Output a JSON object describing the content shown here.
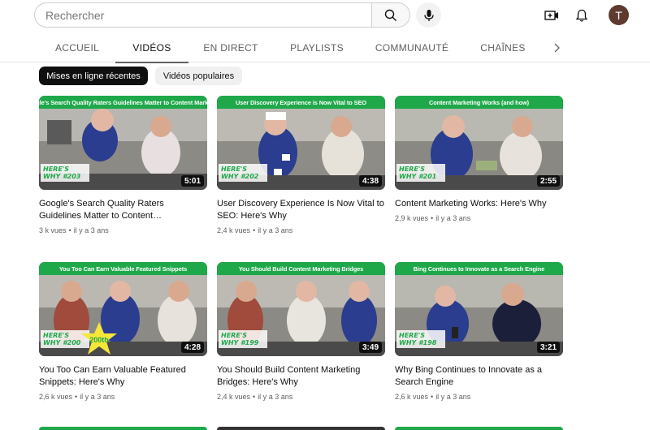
{
  "header": {
    "search_placeholder": "Rechercher",
    "avatar_letter": "T"
  },
  "tabs": [
    {
      "label": "ACCUEIL",
      "active": false
    },
    {
      "label": "VIDÉOS",
      "active": true
    },
    {
      "label": "EN DIRECT",
      "active": false
    },
    {
      "label": "PLAYLISTS",
      "active": false
    },
    {
      "label": "COMMUNAUTÉ",
      "active": false
    },
    {
      "label": "CHAÎNES",
      "active": false
    }
  ],
  "chips": [
    {
      "label": "Mises en ligne récentes",
      "selected": true
    },
    {
      "label": "Vidéos populaires",
      "selected": false
    }
  ],
  "videos": [
    {
      "banner": "Google's Search Quality Raters Guidelines Matter to Content Marketers",
      "logo_line1": "HERE'S",
      "logo_line2": "WHY #203",
      "duration": "5:01",
      "title": "Google's Search Quality Raters Guidelines Matter to Content…",
      "views": "3 k vues",
      "age": "il y a 3 ans"
    },
    {
      "banner": "User Discovery Experience is Now Vital to SEO",
      "logo_line1": "HERE'S",
      "logo_line2": "WHY #202",
      "duration": "4:38",
      "title": "User Discovery Experience Is Now Vital to SEO: Here's Why",
      "views": "2,4 k vues",
      "age": "il y a 3 ans"
    },
    {
      "banner": "Content Marketing Works (and how)",
      "logo_line1": "HERE'S",
      "logo_line2": "WHY #201",
      "duration": "2:55",
      "title": "Content Marketing Works: Here's Why",
      "views": "2,9 k vues",
      "age": "il y a 3 ans"
    },
    {
      "banner": "You Too Can Earn Valuable Featured Snippets",
      "logo_line1": "HERE'S",
      "logo_line2": "WHY #200",
      "duration": "4:28",
      "title": "You Too Can Earn Valuable Featured Snippets: Here's Why",
      "views": "2,6 k vues",
      "age": "il y a 3 ans",
      "star_text": "200th"
    },
    {
      "banner": "You Should Build Content Marketing Bridges",
      "logo_line1": "HERE'S",
      "logo_line2": "WHY #199",
      "duration": "3:49",
      "title": "You Should Build Content Marketing Bridges: Here's Why",
      "views": "2,4 k vues",
      "age": "il y a 3 ans"
    },
    {
      "banner": "Bing Continues to Innovate as a Search Engine",
      "logo_line1": "HERE'S",
      "logo_line2": "WHY #198",
      "duration": "3:21",
      "title": "Why Bing Continues to Innovate as a Search Engine",
      "views": "2,6 k vues",
      "age": "il y a 3 ans"
    }
  ],
  "colors": {
    "banner_green": "#1fa84a",
    "avatar_bg": "#5e3a2f",
    "chip_selected": "#0f0f0f"
  },
  "icons": [
    "search-icon",
    "mic-icon",
    "create-video-icon",
    "bell-icon",
    "chevron-right-icon"
  ]
}
